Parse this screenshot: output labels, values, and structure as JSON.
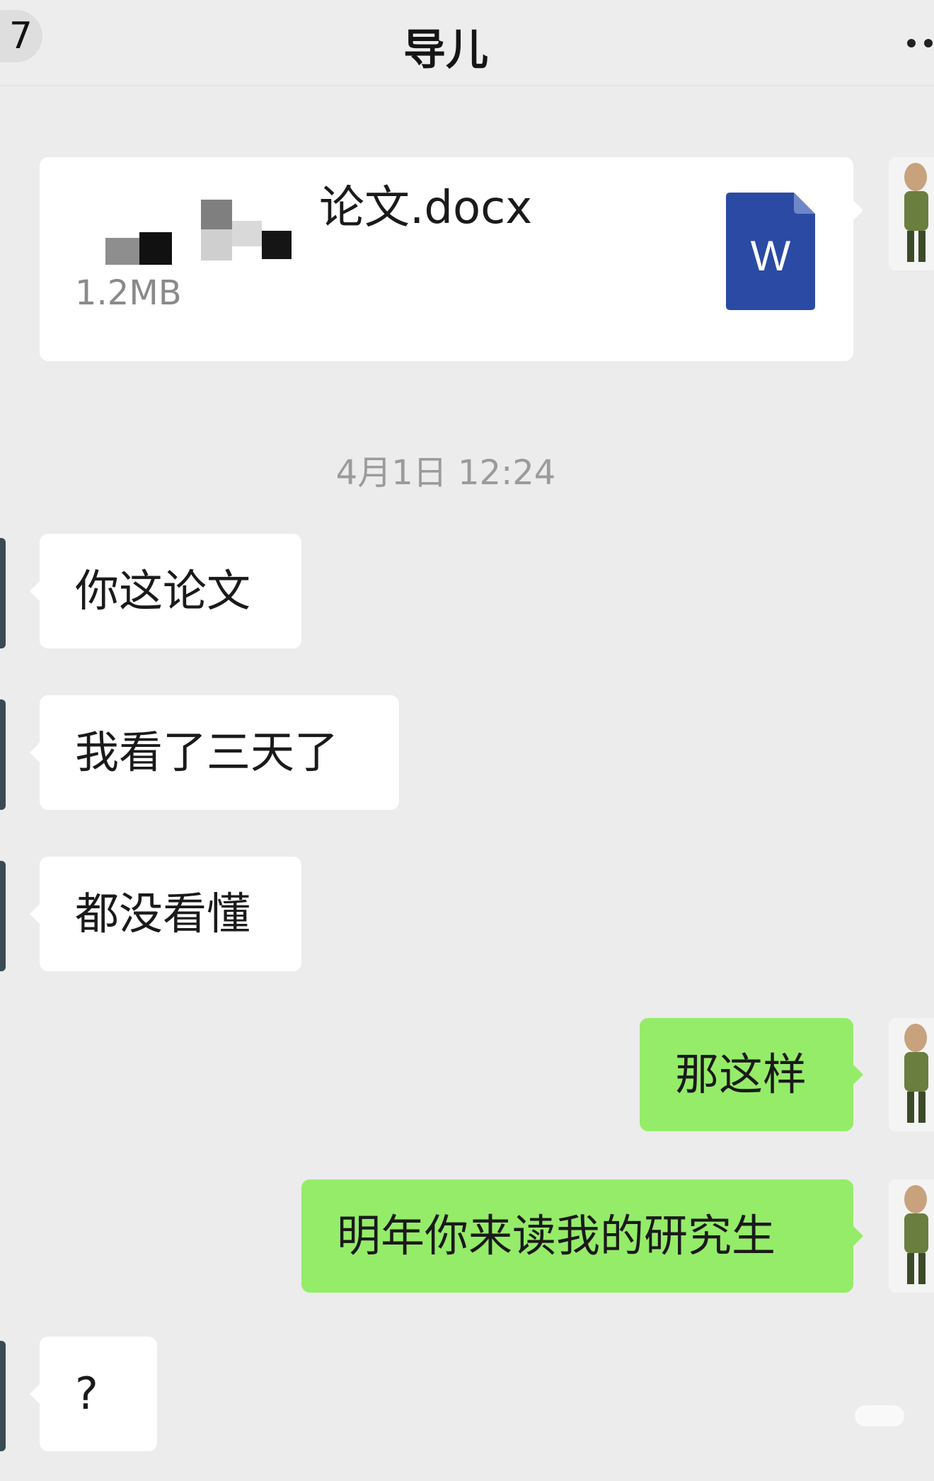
{
  "header": {
    "back_badge": "7",
    "title": "导儿"
  },
  "file_message": {
    "file_name": "论文.docx",
    "file_size": "1.2MB",
    "file_icon_letter": "W",
    "file_icon_color": "#2b4aa3"
  },
  "timestamp": "4月1日 12:24",
  "messages": [
    {
      "side": "received",
      "text": "你这论文"
    },
    {
      "side": "received",
      "text": "我看了三天了"
    },
    {
      "side": "received",
      "text": "都没看懂"
    },
    {
      "side": "sent",
      "text": "那这样"
    },
    {
      "side": "sent",
      "text": "明年你来读我的研究生"
    },
    {
      "side": "received",
      "text": "?"
    }
  ],
  "colors": {
    "chat_background": "#ececec",
    "received_bubble": "#ffffff",
    "sent_bubble": "#95ec69"
  }
}
